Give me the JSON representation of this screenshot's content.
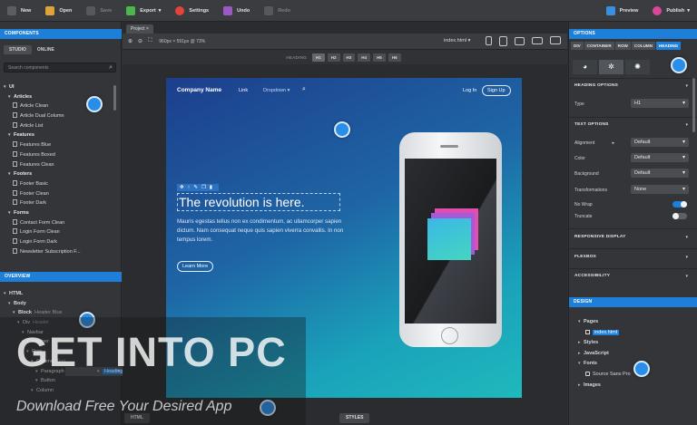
{
  "toolbar": {
    "new": "New",
    "open": "Open",
    "save": "Save",
    "export": "Export",
    "settings": "Settings",
    "undo": "Undo",
    "redo": "Redo",
    "preview": "Preview",
    "publish": "Publish"
  },
  "left": {
    "components_header": "COMPONENTS",
    "tab_studio": "STUDIO",
    "tab_online": "ONLINE",
    "search_placeholder": "Search components",
    "tree": [
      {
        "label": "UI",
        "kind": "cat",
        "depth": 0
      },
      {
        "label": "Articles",
        "kind": "cat",
        "depth": 1
      },
      {
        "label": "Article Clean",
        "kind": "item",
        "depth": 2
      },
      {
        "label": "Article Dual Column",
        "kind": "item",
        "depth": 2
      },
      {
        "label": "Article List",
        "kind": "item",
        "depth": 2
      },
      {
        "label": "Features",
        "kind": "cat",
        "depth": 1
      },
      {
        "label": "Features Blue",
        "kind": "item",
        "depth": 2
      },
      {
        "label": "Features Boxed",
        "kind": "item",
        "depth": 2
      },
      {
        "label": "Features Clean",
        "kind": "item",
        "depth": 2
      },
      {
        "label": "Footers",
        "kind": "cat",
        "depth": 1
      },
      {
        "label": "Footer Basic",
        "kind": "item",
        "depth": 2
      },
      {
        "label": "Footer Clean",
        "kind": "item",
        "depth": 2
      },
      {
        "label": "Footer Dark",
        "kind": "item",
        "depth": 2
      },
      {
        "label": "Forms",
        "kind": "cat",
        "depth": 1
      },
      {
        "label": "Contact Form Clean",
        "kind": "item",
        "depth": 2
      },
      {
        "label": "Login Form Clean",
        "kind": "item",
        "depth": 2
      },
      {
        "label": "Login Form Dark",
        "kind": "item",
        "depth": 2
      },
      {
        "label": "Newsletter Subscription F...",
        "kind": "item",
        "depth": 2
      }
    ],
    "overview_header": "OVERVIEW",
    "overview": [
      {
        "label": "HTML",
        "depth": 0
      },
      {
        "label": "Body",
        "depth": 1
      },
      {
        "label": "Block",
        "extra": "Header Blue",
        "depth": 2
      },
      {
        "label": "Div",
        "extra": "Header",
        "depth": 3
      },
      {
        "label": "Navbar",
        "depth": 4
      },
      {
        "label": "Container",
        "depth": 4
      },
      {
        "label": "Row",
        "depth": 5
      },
      {
        "label": "Column",
        "extra": "Text",
        "depth": 6
      },
      {
        "label": "Heading",
        "depth": 7,
        "selected": true
      },
      {
        "label": "Paragraph",
        "depth": 7
      },
      {
        "label": "Button",
        "depth": 7
      },
      {
        "label": "Column",
        "depth": 6
      }
    ]
  },
  "center": {
    "doc_tab": "Project",
    "size_info": "960px × 591px @ 73%",
    "file": "index.html",
    "heading_label": "HEADING",
    "heading_buttons": [
      "H1",
      "H2",
      "H3",
      "H4",
      "H5",
      "H6"
    ],
    "bottom_html": "HTML",
    "bottom_styles": "STYLES"
  },
  "page": {
    "brand": "Company Name",
    "link": "Link",
    "dropdown": "Dropdown ▾",
    "login": "Log In",
    "signup": "Sign Up",
    "hero_title": "The revolution is here.",
    "hero_text": "Mauris egestas tellus non ex condimentum, ac ullamcorper sapien dictum. Nam consequat neque quis sapien viverra convallis. In non tempus lorem.",
    "learn_more": "Learn More"
  },
  "right": {
    "options_header": "OPTIONS",
    "tags": [
      "DIV",
      "CONTAINER",
      "ROW",
      "COLUMN",
      "HEADING"
    ],
    "heading_options": "HEADING OPTIONS",
    "type_label": "Type",
    "type_value": "H1",
    "text_options": "TEXT OPTIONS",
    "alignment_label": "Alignment",
    "alignment_value": "Default",
    "color_label": "Color",
    "color_value": "Default",
    "background_label": "Background",
    "background_value": "Default",
    "transformations_label": "Transformations",
    "transformations_value": "None",
    "nowrap_label": "No Wrap",
    "truncate_label": "Truncate",
    "responsive_display": "RESPONSIVE DISPLAY",
    "flexbox": "FLEXBOX",
    "accessibility": "ACCESSIBILITY",
    "design_header": "DESIGN",
    "design_tree": [
      {
        "label": "Pages",
        "caret": "▾"
      },
      {
        "label": "index.html",
        "caret": "",
        "file": true,
        "selected": true
      },
      {
        "label": "Styles",
        "caret": "▸"
      },
      {
        "label": "JavaScript",
        "caret": "▸"
      },
      {
        "label": "Fonts",
        "caret": "▾"
      },
      {
        "label": "Source Sans Pro",
        "caret": "",
        "font": true
      },
      {
        "label": "Images",
        "caret": "▸"
      }
    ]
  },
  "watermark": {
    "title": "GET INTO PC",
    "subtitle": "Download Free Your Desired App"
  },
  "colors": {
    "accent": "#1e7fd8",
    "panel": "#333539",
    "canvas_top": "#1d3e8c",
    "canvas_bottom": "#1fb9bd"
  }
}
